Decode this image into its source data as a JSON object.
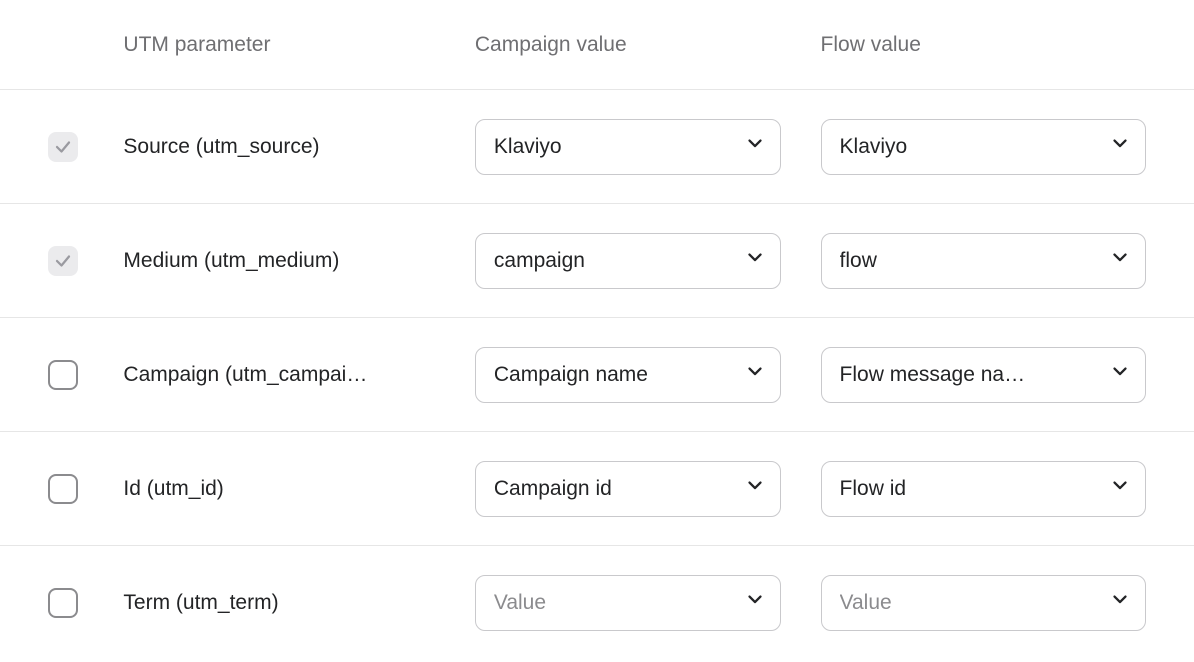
{
  "headers": {
    "param": "UTM parameter",
    "campaign": "Campaign value",
    "flow": "Flow value"
  },
  "rows": [
    {
      "checked": true,
      "locked": true,
      "label": "Source (utm_source)",
      "campaign": {
        "text": "Klaviyo",
        "placeholder": false
      },
      "flow": {
        "text": "Klaviyo",
        "placeholder": false
      }
    },
    {
      "checked": true,
      "locked": true,
      "label": "Medium (utm_medium)",
      "campaign": {
        "text": "campaign",
        "placeholder": false
      },
      "flow": {
        "text": "flow",
        "placeholder": false
      }
    },
    {
      "checked": false,
      "locked": false,
      "label": "Campaign (utm_campai…",
      "campaign": {
        "text": "Campaign name",
        "placeholder": false
      },
      "flow": {
        "text": "Flow message na…",
        "placeholder": false
      }
    },
    {
      "checked": false,
      "locked": false,
      "label": "Id (utm_id)",
      "campaign": {
        "text": "Campaign id",
        "placeholder": false
      },
      "flow": {
        "text": "Flow id",
        "placeholder": false
      }
    },
    {
      "checked": false,
      "locked": false,
      "label": "Term (utm_term)",
      "campaign": {
        "text": "Value",
        "placeholder": true
      },
      "flow": {
        "text": "Value",
        "placeholder": true
      }
    }
  ]
}
